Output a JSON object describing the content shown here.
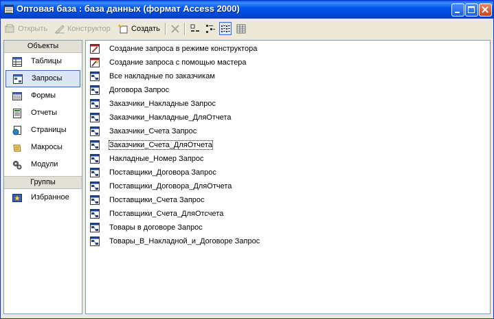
{
  "window": {
    "title": "Оптовая база : база данных (формат Access 2000)"
  },
  "toolbar": {
    "open_label": "Открыть",
    "design_label": "Конструктор",
    "create_label": "Создать"
  },
  "sidebar": {
    "objects_header": "Объекты",
    "items": [
      {
        "label": "Таблицы",
        "icon": "table-icon"
      },
      {
        "label": "Запросы",
        "icon": "query-icon",
        "selected": true
      },
      {
        "label": "Формы",
        "icon": "form-icon"
      },
      {
        "label": "Отчеты",
        "icon": "report-icon"
      },
      {
        "label": "Страницы",
        "icon": "page-icon"
      },
      {
        "label": "Макросы",
        "icon": "macro-icon"
      },
      {
        "label": "Модули",
        "icon": "module-icon"
      }
    ],
    "groups_header": "Группы",
    "group_items": [
      {
        "label": "Избранное",
        "icon": "favorites-icon"
      }
    ]
  },
  "queries": [
    {
      "label": "Создание запроса в режиме конструктора",
      "icon": "wizard-icon"
    },
    {
      "label": "Создание запроса с помощью мастера",
      "icon": "wizard-icon"
    },
    {
      "label": "Все накладные по заказчикам",
      "icon": "query-icon"
    },
    {
      "label": "Договора Запрос",
      "icon": "query-icon"
    },
    {
      "label": "Заказчики_Накладные Запрос",
      "icon": "query-icon"
    },
    {
      "label": "Заказчики_Накладные_ДляОтчета",
      "icon": "query-icon"
    },
    {
      "label": "Заказчики_Счета Запрос",
      "icon": "query-icon"
    },
    {
      "label": "Заказчики_Счета_ДляОтчета",
      "icon": "query-icon",
      "focused": true
    },
    {
      "label": "Накладные_Номер Запрос",
      "icon": "query-icon"
    },
    {
      "label": "Поставщики_Договора Запрос",
      "icon": "query-icon"
    },
    {
      "label": "Поставщики_Договора_ДляОтчета",
      "icon": "query-icon"
    },
    {
      "label": "Поставщики_Счета Запрос",
      "icon": "query-icon"
    },
    {
      "label": "Поставщики_Счета_ДляОтсчета",
      "icon": "query-icon"
    },
    {
      "label": "Товары в договоре Запрос",
      "icon": "query-icon"
    },
    {
      "label": "Товары_В_Накладной_и_Договоре Запрос",
      "icon": "query-icon"
    }
  ],
  "colors": {
    "titlebar": "#0054e3",
    "selection": "#316ac5",
    "window_bg": "#ece9d8"
  }
}
